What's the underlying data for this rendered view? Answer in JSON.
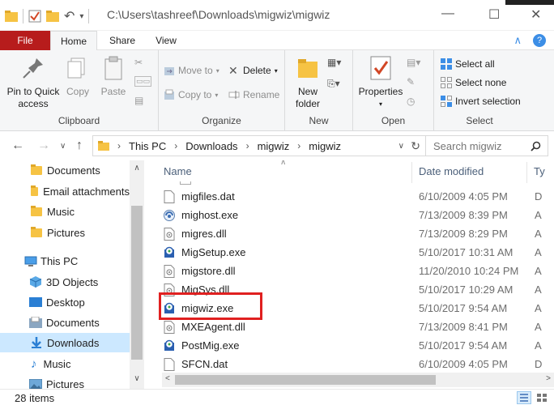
{
  "title_bar": {
    "path": "C:\\Users\\tashreef\\Downloads\\migwiz\\migwiz",
    "minimize": "—",
    "maximize": "☐",
    "close": "✕"
  },
  "ribbon_tabs": {
    "file": "File",
    "home": "Home",
    "share": "Share",
    "view": "View"
  },
  "ribbon": {
    "clipboard": {
      "label": "Clipboard",
      "pin_to_quick_access": "Pin to Quick\naccess",
      "copy": "Copy",
      "paste": "Paste"
    },
    "organize": {
      "label": "Organize",
      "move_to": "Move to",
      "copy_to": "Copy to",
      "delete": "Delete",
      "rename": "Rename"
    },
    "new": {
      "label": "New",
      "new_folder": "New\nfolder"
    },
    "open": {
      "label": "Open",
      "properties": "Properties"
    },
    "select": {
      "label": "Select",
      "select_all": "Select all",
      "select_none": "Select none",
      "invert_selection": "Invert selection"
    }
  },
  "address_bar": {
    "crumbs": [
      "This PC",
      "Downloads",
      "migwiz",
      "migwiz"
    ],
    "search_placeholder": "Search migwiz"
  },
  "nav_pane": {
    "items": [
      {
        "label": "Documents",
        "icon": "folder-icon"
      },
      {
        "label": "Email attachments",
        "icon": "folder-icon"
      },
      {
        "label": "Music",
        "icon": "folder-icon"
      },
      {
        "label": "Pictures",
        "icon": "folder-icon"
      },
      {
        "label": "This PC",
        "icon": "this-pc-icon"
      },
      {
        "label": "3D Objects",
        "icon": "3d-objects-icon"
      },
      {
        "label": "Desktop",
        "icon": "desktop-icon"
      },
      {
        "label": "Documents",
        "icon": "documents-icon"
      },
      {
        "label": "Downloads",
        "icon": "downloads-icon",
        "selected": true
      },
      {
        "label": "Music",
        "icon": "music-icon"
      },
      {
        "label": "Pictures",
        "icon": "pictures-icon"
      }
    ]
  },
  "file_list": {
    "columns": {
      "name": "Name",
      "date_modified": "Date modified",
      "type": "Ty"
    },
    "rows": [
      {
        "name": "migfiles.dat",
        "date": "6/10/2009 4:05 PM",
        "type": "D",
        "icon": "file-icon"
      },
      {
        "name": "mighost.exe",
        "date": "7/13/2009 8:39 PM",
        "type": "A",
        "icon": "app-icon"
      },
      {
        "name": "migres.dll",
        "date": "7/13/2009 8:29 PM",
        "type": "A",
        "icon": "dll-icon"
      },
      {
        "name": "MigSetup.exe",
        "date": "5/10/2017 10:31 AM",
        "type": "A",
        "icon": "setup-icon"
      },
      {
        "name": "migstore.dll",
        "date": "11/20/2010 10:24 PM",
        "type": "A",
        "icon": "dll-icon"
      },
      {
        "name": "MigSys.dll",
        "date": "5/10/2017 10:29 AM",
        "type": "A",
        "icon": "dll-icon"
      },
      {
        "name": "migwiz.exe",
        "date": "5/10/2017 9:54 AM",
        "type": "A",
        "icon": "setup-icon"
      },
      {
        "name": "MXEAgent.dll",
        "date": "7/13/2009 8:41 PM",
        "type": "A",
        "icon": "dll-icon"
      },
      {
        "name": "PostMig.exe",
        "date": "5/10/2017 9:54 AM",
        "type": "A",
        "icon": "setup-icon"
      },
      {
        "name": "SFCN.dat",
        "date": "6/10/2009 4:05 PM",
        "type": "D",
        "icon": "file-icon"
      }
    ]
  },
  "status_bar": {
    "item_count": "28 items"
  },
  "colors": {
    "file_tab": "#b71c1c",
    "highlight_box": "#e02020",
    "selected_nav": "#cce8ff",
    "folder": "#f6c344"
  }
}
